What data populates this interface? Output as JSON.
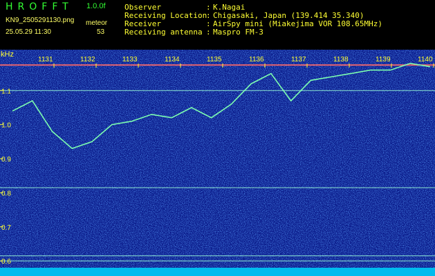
{
  "header": {
    "logo": "HROFFT",
    "version": "1.0.0f",
    "filename": "KN9_2505291130.png",
    "timestamp": "25.05.29 11:30",
    "meteor_label": "meteor",
    "meteor_count": "53",
    "fields": [
      {
        "label": "Observer",
        "value": "K.Nagai"
      },
      {
        "label": "Receiving Location",
        "value": "Chigasaki, Japan (139.414 35.340)"
      },
      {
        "label": "Receiver",
        "value": "AirSpy mini (Miakejima VOR 108.65MHz)"
      },
      {
        "label": "Receiving antenna",
        "value": "Maspro FM-3"
      }
    ],
    "colon": ":"
  },
  "chart_data": {
    "type": "heatmap",
    "ylabel": "kHz",
    "ylim": [
      0.58,
      1.22
    ],
    "yticks": [
      0.6,
      0.7,
      0.8,
      0.9,
      1.0,
      1.1
    ],
    "ytick_labels": [
      "0.6",
      "0.7",
      "0.8",
      "0.9",
      "1.0",
      "1.1"
    ],
    "xticks": [
      "1131",
      "1132",
      "1133",
      "1134",
      "1135",
      "1136",
      "1137",
      "1138",
      "1139",
      "1140"
    ],
    "xlim": [
      11.3,
      11.405
    ],
    "horizontal_lines_khz": [
      1.175,
      1.1,
      0.815,
      0.615,
      0.6
    ],
    "trace": {
      "x": [
        11.3,
        11.305,
        11.31,
        11.315,
        11.32,
        11.325,
        11.33,
        11.335,
        11.34,
        11.345,
        11.35,
        11.355,
        11.36,
        11.365,
        11.37,
        11.375,
        11.38,
        11.385,
        11.39,
        11.395,
        11.4,
        11.405
      ],
      "y": [
        1.04,
        1.07,
        0.98,
        0.93,
        0.95,
        1.0,
        1.01,
        1.03,
        1.02,
        1.05,
        1.02,
        1.06,
        1.12,
        1.15,
        1.07,
        1.13,
        1.14,
        1.15,
        1.16,
        1.16,
        1.18,
        1.17
      ]
    }
  }
}
